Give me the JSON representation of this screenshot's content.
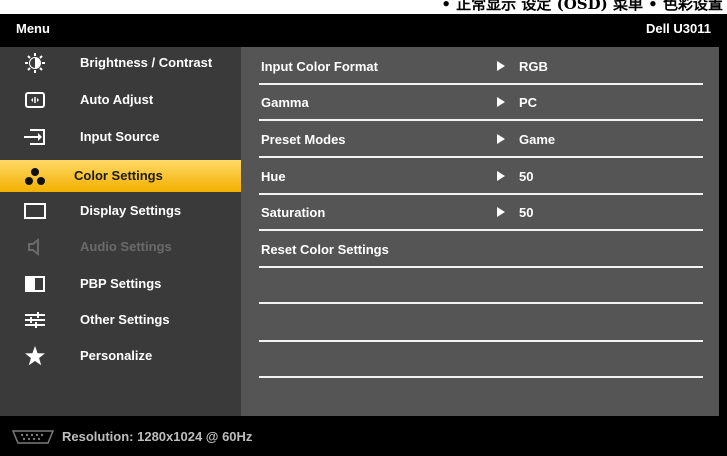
{
  "page_edge_text": "• 正常显示 设定 (OSD) 菜单 • 色彩设置",
  "title": {
    "left": "Menu",
    "right": "Dell U3011"
  },
  "sidebar": {
    "items": [
      {
        "label": "Brightness / Contrast",
        "icon": "brightness-icon",
        "state": "normal"
      },
      {
        "label": "Auto Adjust",
        "icon": "auto-adjust-icon",
        "state": "normal"
      },
      {
        "label": "Input Source",
        "icon": "input-source-icon",
        "state": "normal"
      },
      {
        "label": "Color Settings",
        "icon": "color-settings-icon",
        "state": "selected"
      },
      {
        "label": "Display Settings",
        "icon": "display-settings-icon",
        "state": "normal"
      },
      {
        "label": "Audio Settings",
        "icon": "audio-settings-icon",
        "state": "disabled"
      },
      {
        "label": "PBP Settings",
        "icon": "pbp-settings-icon",
        "state": "normal"
      },
      {
        "label": "Other Settings",
        "icon": "other-settings-icon",
        "state": "normal"
      },
      {
        "label": "Personalize",
        "icon": "star-icon",
        "state": "normal"
      }
    ]
  },
  "settings": {
    "rows": [
      {
        "label": "Input Color Format",
        "value": "RGB"
      },
      {
        "label": "Gamma",
        "value": "PC"
      },
      {
        "label": "Preset Modes",
        "value": "Game"
      },
      {
        "label": "Hue",
        "value": "50"
      },
      {
        "label": "Saturation",
        "value": "50"
      },
      {
        "label": "Reset Color Settings",
        "value": ""
      },
      {
        "label": "",
        "value": ""
      },
      {
        "label": "",
        "value": ""
      },
      {
        "label": "",
        "value": ""
      }
    ]
  },
  "status": {
    "text": "Resolution: 1280x1024 @ 60Hz",
    "icon": "vga-connector-icon"
  },
  "colors": {
    "selected": "#f2b000",
    "sidebar_bg": "#3a3a3a",
    "content_bg": "#555555"
  }
}
